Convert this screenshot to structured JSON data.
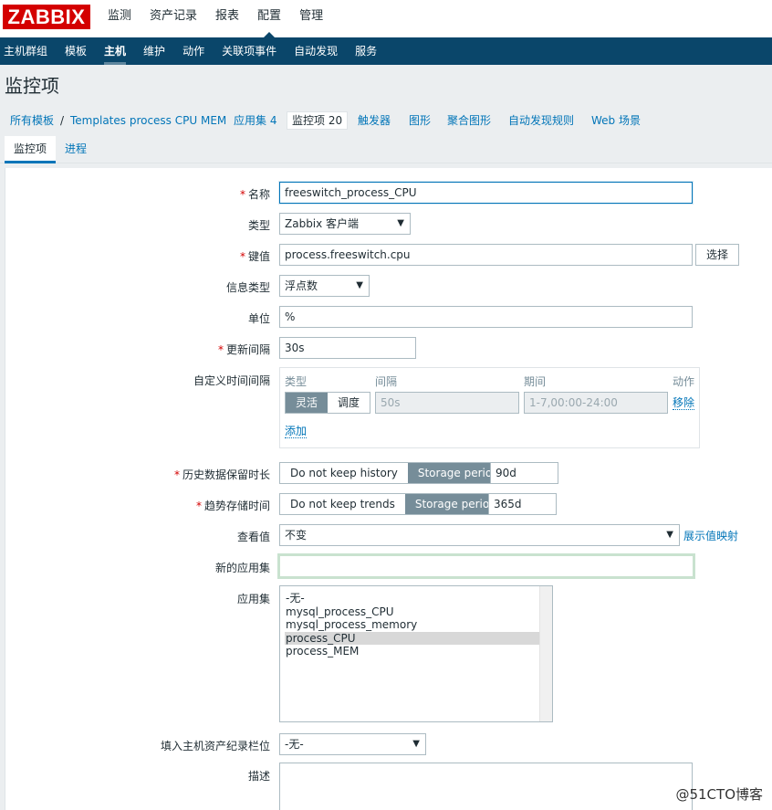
{
  "logo": "ZABBIX",
  "topnav": [
    "监测",
    "资产记录",
    "报表",
    "配置",
    "管理"
  ],
  "subnav": [
    "主机群组",
    "模板",
    "主机",
    "维护",
    "动作",
    "关联项事件",
    "自动发现",
    "服务"
  ],
  "page_title": "监控项",
  "breadcrumbs": {
    "all_templates": "所有模板",
    "sep": "/",
    "template": "Templates process CPU MEM",
    "applications": "应用集 4",
    "items": "监控项 20",
    "triggers": "触发器",
    "graphs": "图形",
    "screens": "聚合图形",
    "discovery": "自动发现规则",
    "web": "Web 场景"
  },
  "tabs": [
    "监控项",
    "进程"
  ],
  "form": {
    "required_mark": "*",
    "name_label": "名称",
    "name_value": "freeswitch_process_CPU",
    "type_label": "类型",
    "type_value": "Zabbix 客户端",
    "key_label": "键值",
    "key_value": "process.freeswitch.cpu",
    "select_button": "选择",
    "info_type_label": "信息类型",
    "info_type_value": "浮点数",
    "units_label": "单位",
    "units_value": "%",
    "interval_label": "更新间隔",
    "interval_value": "30s",
    "custom_intervals_label": "自定义时间间隔",
    "custom_intervals": {
      "col_type": "类型",
      "col_interval": "间隔",
      "col_period": "期间",
      "col_action": "动作",
      "flexible": "灵活",
      "scheduling": "调度",
      "interval_placeholder": "50s",
      "period_placeholder": "1-7,00:00-24:00",
      "remove": "移除",
      "add": "添加"
    },
    "history_label": "历史数据保留时长",
    "history_no_keep": "Do not keep history",
    "history_storage": "Storage period",
    "history_value": "90d",
    "trends_label": "趋势存储时间",
    "trends_no_keep": "Do not keep trends",
    "trends_storage": "Storage period",
    "trends_value": "365d",
    "valuemap_label": "查看值",
    "valuemap_value": "不变",
    "valuemap_link": "展示值映射",
    "new_app_label": "新的应用集",
    "new_app_value": "",
    "apps_label": "应用集",
    "apps_options": [
      "-无-",
      "mysql_process_CPU",
      "mysql_process_memory",
      "process_CPU",
      "process_MEM"
    ],
    "apps_selected_index": 3,
    "inventory_label": "填入主机资产纪录栏位",
    "inventory_value": "-无-",
    "description_label": "描述"
  },
  "watermark": "@51CTO博客",
  "colors": {
    "logo_bg": "#d40000",
    "subnav_bg": "#0a466a",
    "link": "#0275b8",
    "segment_on": "#768d99",
    "required": "#d40000"
  }
}
